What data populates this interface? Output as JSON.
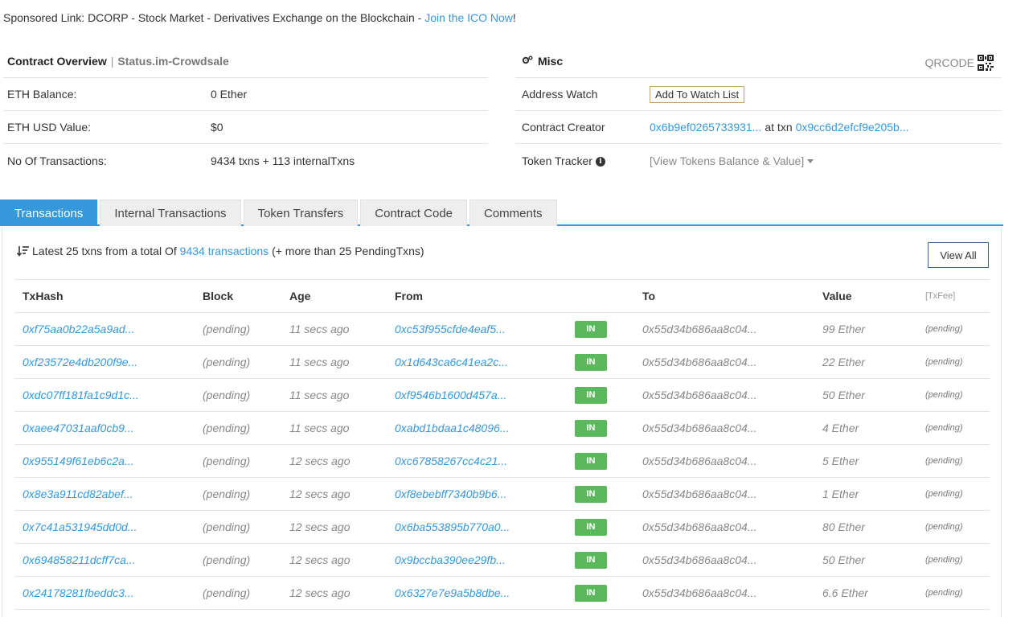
{
  "sponsored": {
    "prefix": "Sponsored Link: DCORP - Stock Market - Derivatives Exchange on the Blockchain -",
    "link": "Join the ICO Now",
    "suffix": "!"
  },
  "overview": {
    "title": "Contract Overview",
    "separator": "|",
    "subtitle": "Status.im-Crowdsale",
    "rows": [
      {
        "label": "ETH Balance:",
        "value": "0 Ether"
      },
      {
        "label": "ETH USD Value:",
        "value": "$0"
      },
      {
        "label": "No Of Transactions:",
        "value": "9434 txns + 113 internalTxns"
      }
    ]
  },
  "misc": {
    "title": "Misc",
    "qrcode_label": "QRCODE",
    "address_watch_label": "Address Watch",
    "watch_button": "Add To Watch List",
    "creator_label": "Contract Creator",
    "creator_address": "0x6b9ef0265733931...",
    "creator_at": "at txn",
    "creator_txn": "0x9cc6d2efcf9e205b...",
    "token_tracker_label": "Token Tracker",
    "token_tracker_value": "[View Tokens Balance & Value]"
  },
  "tabs": [
    {
      "label": "Transactions",
      "active": true
    },
    {
      "label": "Internal Transactions",
      "active": false
    },
    {
      "label": "Token Transfers",
      "active": false
    },
    {
      "label": "Contract Code",
      "active": false
    },
    {
      "label": "Comments",
      "active": false
    }
  ],
  "transactions": {
    "summary_prefix": "Latest 25 txns from a total Of",
    "summary_link": "9434 transactions",
    "summary_suffix": "(+ more than 25 PendingTxns)",
    "view_all": "View All",
    "headers": {
      "txhash": "TxHash",
      "block": "Block",
      "age": "Age",
      "from": "From",
      "to": "To",
      "value": "Value",
      "fee": "[TxFee]"
    },
    "rows": [
      {
        "hash": "0xf75aa0b22a5a9ad...",
        "block": "(pending)",
        "age": "11 secs ago",
        "from": "0xc53f955cfde4eaf5...",
        "dir": "IN",
        "to": "0x55d34b686aa8c04...",
        "value": "99 Ether",
        "fee": "(pending)"
      },
      {
        "hash": "0xf23572e4db200f9e...",
        "block": "(pending)",
        "age": "11 secs ago",
        "from": "0x1d643ca6c41ea2c...",
        "dir": "IN",
        "to": "0x55d34b686aa8c04...",
        "value": "22 Ether",
        "fee": "(pending)"
      },
      {
        "hash": "0xdc07ff181fa1c9d1c...",
        "block": "(pending)",
        "age": "11 secs ago",
        "from": "0xf9546b1600d457a...",
        "dir": "IN",
        "to": "0x55d34b686aa8c04...",
        "value": "50 Ether",
        "fee": "(pending)"
      },
      {
        "hash": "0xaee47031aaf0cb9...",
        "block": "(pending)",
        "age": "11 secs ago",
        "from": "0xabd1bdaa1c48096...",
        "dir": "IN",
        "to": "0x55d34b686aa8c04...",
        "value": "4 Ether",
        "fee": "(pending)"
      },
      {
        "hash": "0x955149f61eb6c2a...",
        "block": "(pending)",
        "age": "12 secs ago",
        "from": "0xc67858267cc4c21...",
        "dir": "IN",
        "to": "0x55d34b686aa8c04...",
        "value": "5 Ether",
        "fee": "(pending)"
      },
      {
        "hash": "0x8e3a911cd82abef...",
        "block": "(pending)",
        "age": "12 secs ago",
        "from": "0xf8ebebff7340b9b6...",
        "dir": "IN",
        "to": "0x55d34b686aa8c04...",
        "value": "1 Ether",
        "fee": "(pending)"
      },
      {
        "hash": "0x7c41a531945dd0d...",
        "block": "(pending)",
        "age": "12 secs ago",
        "from": "0x6ba553895b770a0...",
        "dir": "IN",
        "to": "0x55d34b686aa8c04...",
        "value": "80 Ether",
        "fee": "(pending)"
      },
      {
        "hash": "0x694858211dcff7ca...",
        "block": "(pending)",
        "age": "12 secs ago",
        "from": "0x9bccba390ee29fb...",
        "dir": "IN",
        "to": "0x55d34b686aa8c04...",
        "value": "50 Ether",
        "fee": "(pending)"
      },
      {
        "hash": "0x24178281fbeddc3...",
        "block": "(pending)",
        "age": "12 secs ago",
        "from": "0x6327e7e9a5b8dbe...",
        "dir": "IN",
        "to": "0x55d34b686aa8c04...",
        "value": "6.6 Ether",
        "fee": "(pending)"
      }
    ]
  }
}
